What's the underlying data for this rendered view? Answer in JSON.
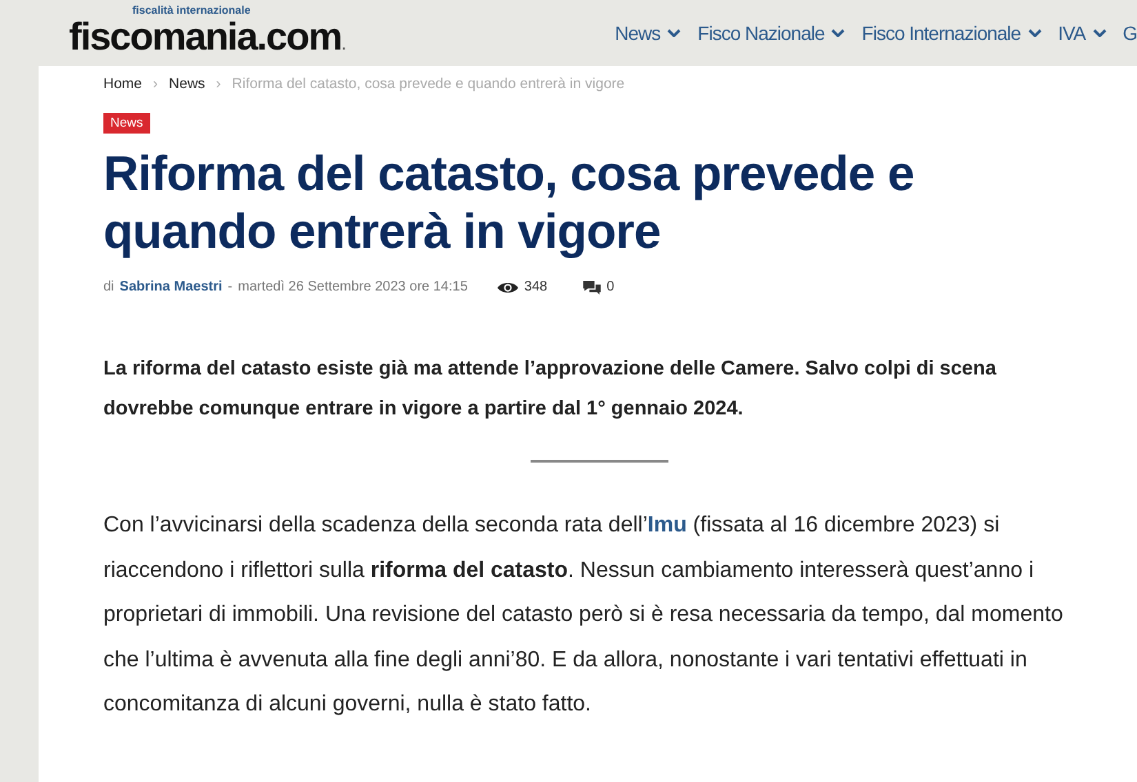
{
  "header": {
    "logo": "fiscomania.com",
    "logo_dot": ".",
    "tagline": "fiscalità internazionale",
    "nav": [
      {
        "label": "News",
        "dropdown": true
      },
      {
        "label": "Fisco Nazionale",
        "dropdown": true
      },
      {
        "label": "Fisco Internazionale",
        "dropdown": true
      },
      {
        "label": "IVA",
        "dropdown": true
      },
      {
        "label": "G",
        "dropdown": false
      }
    ]
  },
  "breadcrumb_separator": "›",
  "breadcrumb": [
    {
      "label": "Home",
      "current": false
    },
    {
      "label": "News",
      "current": false
    },
    {
      "label": "Riforma del catasto, cosa prevede e quando entrerà in vigore",
      "current": true
    }
  ],
  "category": "News",
  "title": "Riforma del catasto, cosa prevede e quando entrerà in vigore",
  "meta": {
    "by": "di",
    "author": "Sabrina Maestri",
    "separator": "-",
    "date": "martedì 26 Settembre 2023 ore 14:15",
    "views": "348",
    "comments": "0"
  },
  "lead": "La riforma del catasto esiste già ma attende l’approvazione delle Camere. Salvo colpi di scena dovrebbe comunque entrare in vigore a partire dal 1° gennaio 2024.",
  "paragraph": [
    {
      "kind": "text",
      "text": "Con l’avvicinarsi della scadenza della seconda rata dell’"
    },
    {
      "kind": "link",
      "text": "Imu"
    },
    {
      "kind": "text",
      "text": " (fissata al 16 dicembre 2023) si riaccendono i riflettori sulla **riforma del catasto**. Nessun cambiamento interesserà quest’anno i proprietari di immobili. Una revisione del catasto però si è resa necessaria da tempo, dal momento che l’ultima è avvenuta alla fine degli anni’80. E da allora, nonostante i vari tentativi effettuati in concomitanza di alcuni governi, nulla è stato fatto."
    }
  ]
}
